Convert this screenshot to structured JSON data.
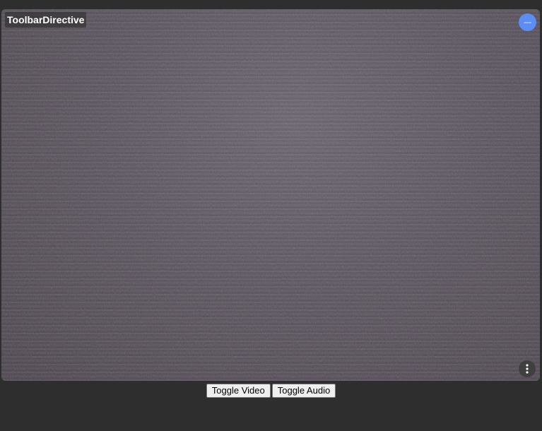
{
  "video_tile": {
    "participant_name": "ToolbarDirective",
    "status_badge": "---",
    "menu_icon": "more-vertical-icon",
    "badge_color": "#5b8df5"
  },
  "controls": {
    "toggle_video_label": "Toggle Video",
    "toggle_audio_label": "Toggle Audio"
  },
  "colors": {
    "page_background": "#2e2e2e",
    "button_background": "#efefef"
  }
}
